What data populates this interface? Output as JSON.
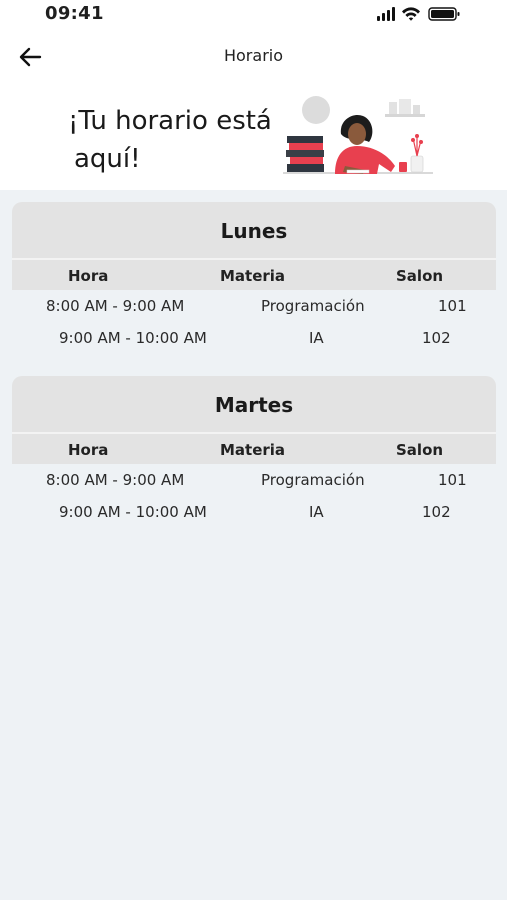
{
  "status_bar": {
    "time": "09:41"
  },
  "header": {
    "title": "Horario",
    "back_icon": "arrow-left-icon"
  },
  "hero": {
    "line1": "¡Tu horario está",
    "line2": "aquí!"
  },
  "columns": {
    "hora": "Hora",
    "materia": "Materia",
    "salon": "Salon"
  },
  "schedule": [
    {
      "day": "Lunes",
      "rows": [
        {
          "hora": "8:00 AM - 9:00 AM",
          "materia": "Programación",
          "salon": "101"
        },
        {
          "hora": "9:00 AM - 10:00 AM",
          "materia": "IA",
          "salon": "102"
        }
      ]
    },
    {
      "day": "Martes",
      "rows": [
        {
          "hora": "8:00 AM - 9:00 AM",
          "materia": "Programación",
          "salon": "101"
        },
        {
          "hora": "9:00 AM - 10:00 AM",
          "materia": "IA",
          "salon": "102"
        }
      ]
    }
  ],
  "colors": {
    "background": "#eef2f5",
    "card_header": "#e3e3e3",
    "accent": "#e8404f"
  }
}
